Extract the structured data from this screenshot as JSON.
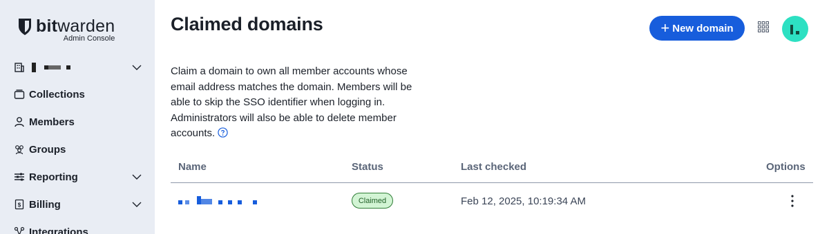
{
  "brand": {
    "name_bold": "bit",
    "name_rest": "warden",
    "subtitle": "Admin Console",
    "accent_color": "#175ddc"
  },
  "sidebar": {
    "org_switcher": {
      "icon": "building-icon"
    },
    "items": [
      {
        "label": "Collections",
        "icon": "collection-icon",
        "expandable": false
      },
      {
        "label": "Members",
        "icon": "user-icon",
        "expandable": false
      },
      {
        "label": "Groups",
        "icon": "users-icon",
        "expandable": false
      },
      {
        "label": "Reporting",
        "icon": "sliders-icon",
        "expandable": true
      },
      {
        "label": "Billing",
        "icon": "billing-icon",
        "expandable": true
      },
      {
        "label": "Integrations",
        "icon": "integrations-icon",
        "expandable": false
      }
    ]
  },
  "header": {
    "title": "Claimed domains",
    "new_domain_label": "New domain"
  },
  "description": "Claim a domain to own all member accounts whose email address matches the domain. Members will be able to skip the SSO identifier when logging in. Administrators will also be able to delete member accounts.",
  "table": {
    "columns": [
      "Name",
      "Status",
      "Last checked",
      "Options"
    ],
    "rows": [
      {
        "status": "Claimed",
        "last_checked": "Feb 12, 2025, 10:19:34 AM"
      }
    ]
  }
}
